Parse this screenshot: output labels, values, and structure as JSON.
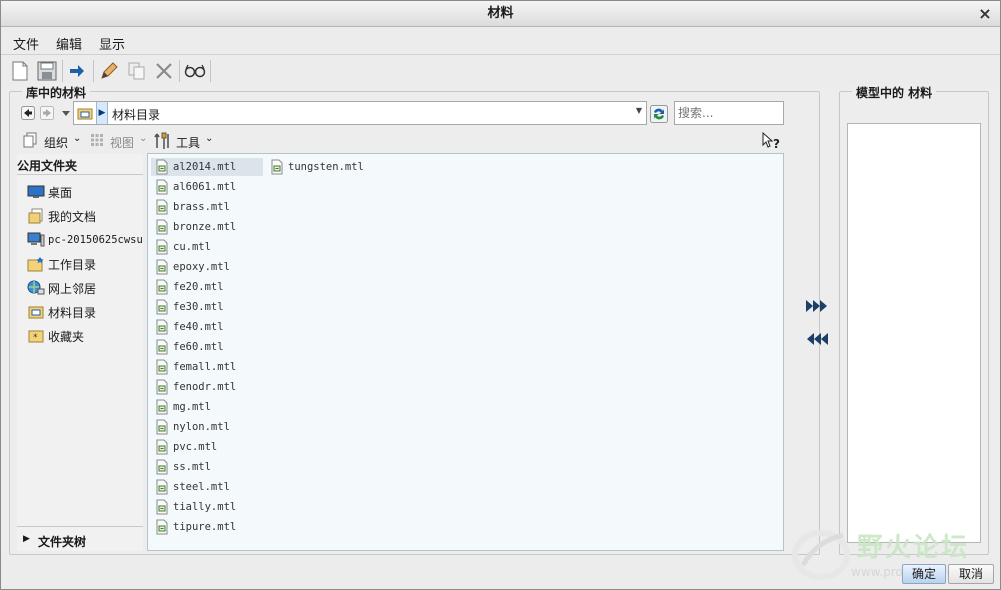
{
  "window": {
    "title": "材料",
    "close_label": "×"
  },
  "menu": {
    "file": "文件",
    "edit": "编辑",
    "view": "显示"
  },
  "library_panel": {
    "title": "库中的材料",
    "path": "材料目录",
    "search_placeholder": "搜索...",
    "organize_label": "组织",
    "view_label": "视图",
    "tools_label": "工具",
    "help_label": "?"
  },
  "left_pane": {
    "header": "公用文件夹",
    "items": [
      {
        "label": "桌面",
        "icon": "desktop-icon"
      },
      {
        "label": "我的文档",
        "icon": "documents-icon"
      },
      {
        "label": "pc-20150625cwsu",
        "icon": "computer-icon"
      },
      {
        "label": "工作目录",
        "icon": "working-directory-icon"
      },
      {
        "label": "网上邻居",
        "icon": "network-icon"
      },
      {
        "label": "材料目录",
        "icon": "material-folder-icon"
      },
      {
        "label": "收藏夹",
        "icon": "favorites-icon"
      }
    ],
    "tree_label": "文件夹树"
  },
  "files": [
    "al2014.mtl",
    "al6061.mtl",
    "brass.mtl",
    "bronze.mtl",
    "cu.mtl",
    "epoxy.mtl",
    "fe20.mtl",
    "fe30.mtl",
    "fe40.mtl",
    "fe60.mtl",
    "femall.mtl",
    "fenodr.mtl",
    "mg.mtl",
    "nylon.mtl",
    "pvc.mtl",
    "ss.mtl",
    "steel.mtl",
    "tially.mtl",
    "tipure.mtl",
    "tungsten.mtl"
  ],
  "selected_file": "al2014.mtl",
  "model_panel": {
    "title": "模型中的 材料"
  },
  "buttons": {
    "ok": "确定",
    "cancel": "取消"
  },
  "watermark": {
    "text": "野火论坛",
    "url": "www.proewildfire.cn"
  },
  "colors": {
    "accent": "#1f5fa8",
    "selection": "#dbe4ea",
    "file_area_bg": "#f4f9fb"
  }
}
